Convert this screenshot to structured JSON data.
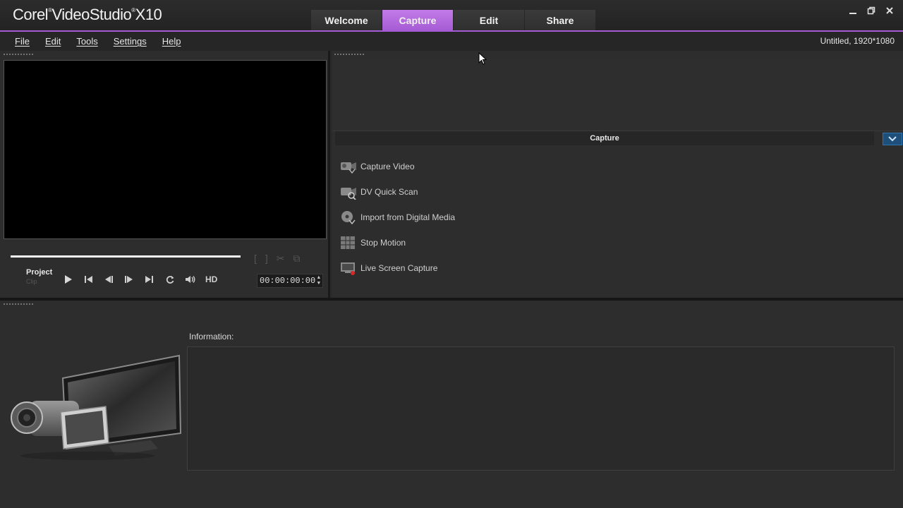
{
  "app": {
    "logo_brand": "Corel",
    "logo_product": "VideoStudio",
    "logo_version": "X10"
  },
  "tabs": [
    {
      "label": "Welcome",
      "active": false
    },
    {
      "label": "Capture",
      "active": true
    },
    {
      "label": "Edit",
      "active": false
    },
    {
      "label": "Share",
      "active": false
    }
  ],
  "window_controls": {
    "minimize": "minimize-icon",
    "restore": "restore-icon",
    "close": "close-icon"
  },
  "menu": [
    {
      "label": "File"
    },
    {
      "label": "Edit"
    },
    {
      "label": "Tools"
    },
    {
      "label": "Settings"
    },
    {
      "label": "Help"
    }
  ],
  "project_info": "Untitled, 1920*1080",
  "player": {
    "mode_project": "Project",
    "mode_clip": "Clip",
    "timecode": "00:00:00:00",
    "hd_label": "HD"
  },
  "capture": {
    "header": "Capture",
    "options": [
      {
        "label": "Capture Video",
        "icon": "camcorder-icon"
      },
      {
        "label": "DV Quick Scan",
        "icon": "dv-scan-icon"
      },
      {
        "label": "Import from Digital Media",
        "icon": "disc-import-icon"
      },
      {
        "label": "Stop Motion",
        "icon": "film-grid-icon"
      },
      {
        "label": "Live Screen Capture",
        "icon": "screen-record-icon"
      }
    ]
  },
  "information": {
    "label": "Information:"
  },
  "colors": {
    "accent": "#a55bd3",
    "background": "#2d2d2d",
    "collapse_button": "#1d4f7a"
  }
}
